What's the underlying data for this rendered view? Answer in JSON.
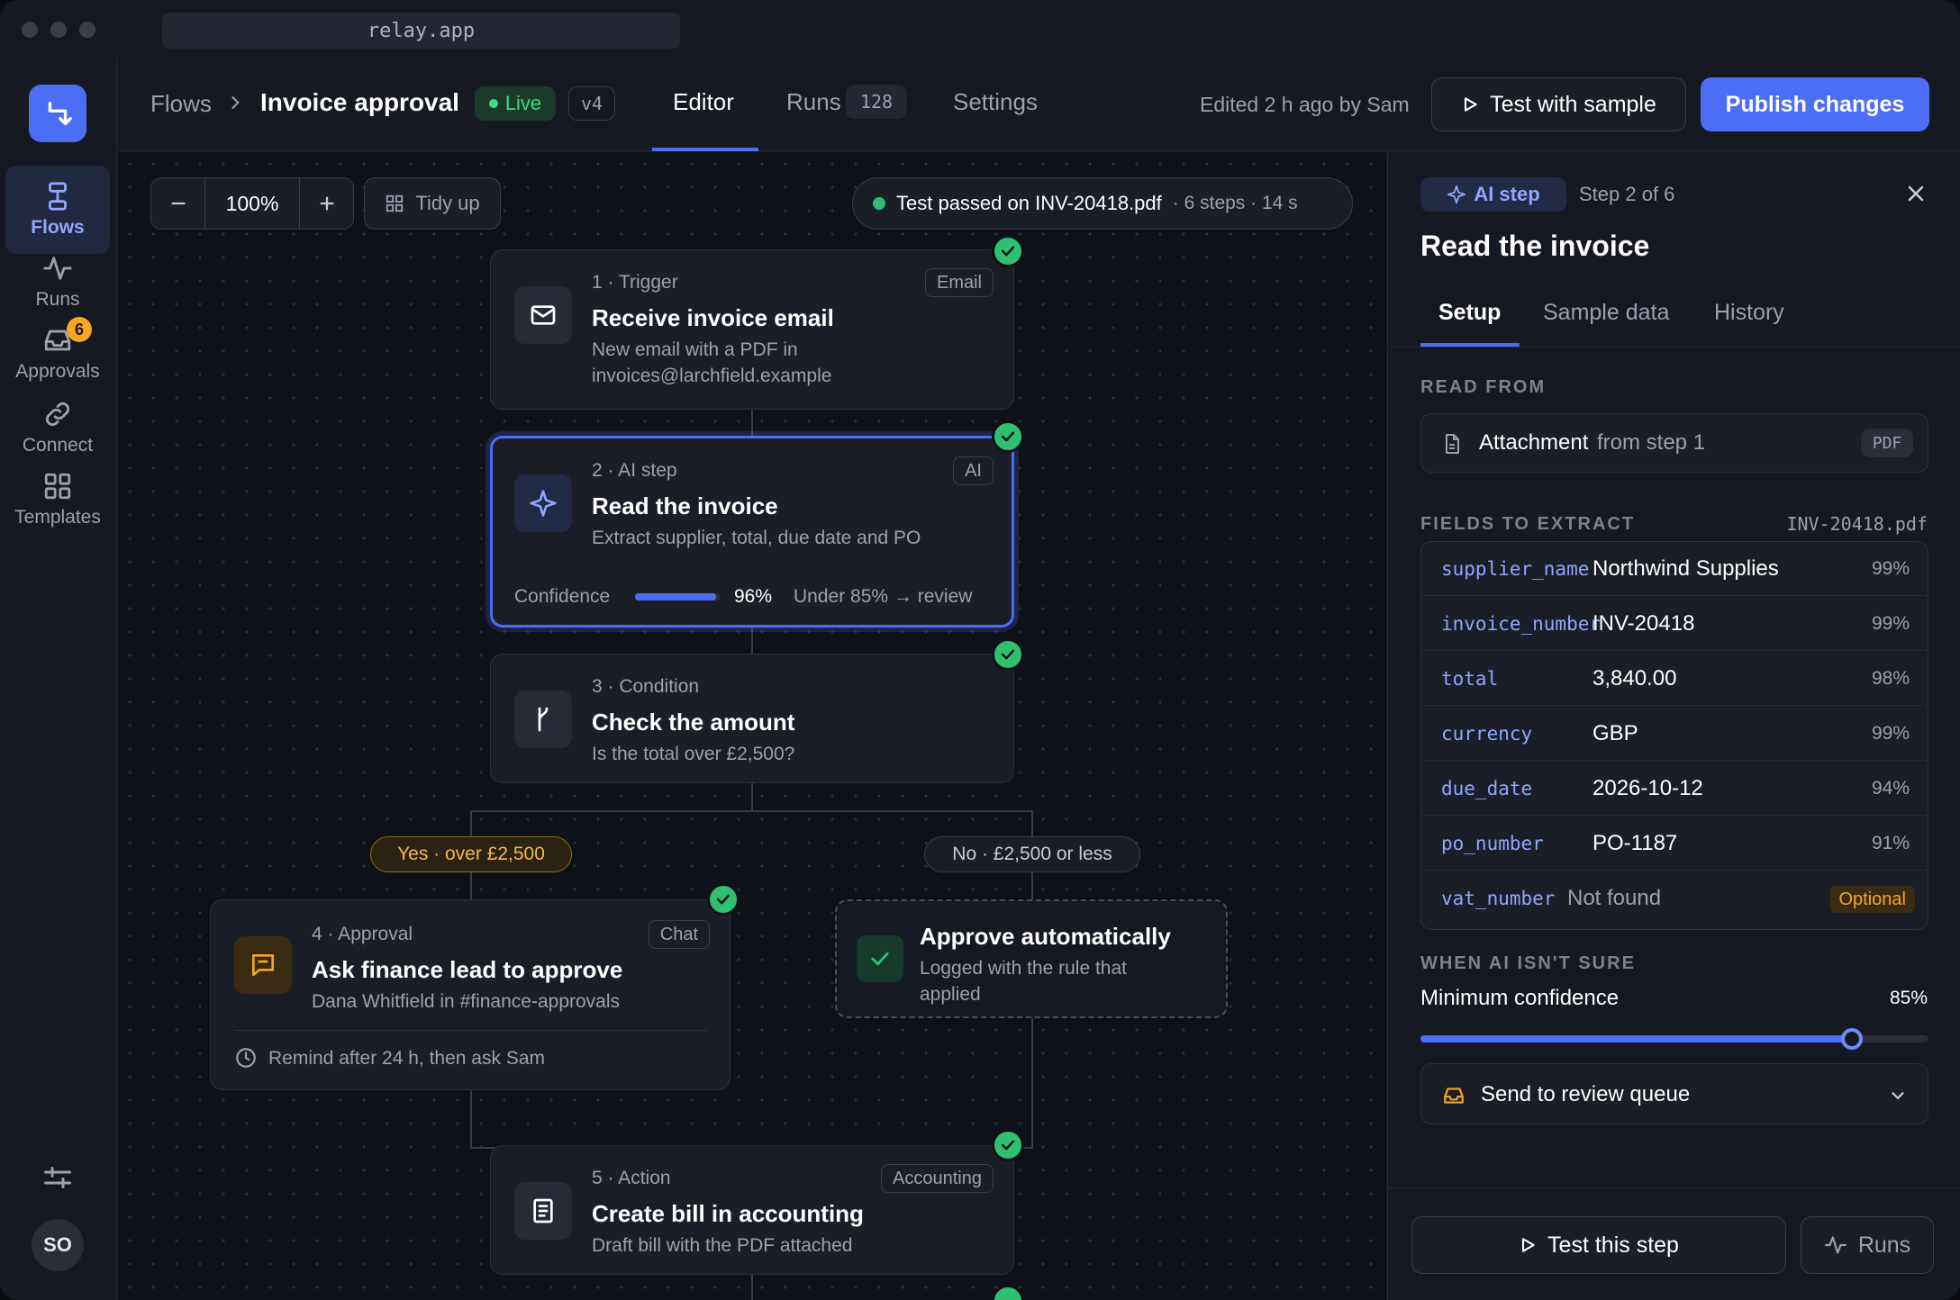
{
  "browser": {
    "url": "relay.app"
  },
  "rail": {
    "items": [
      {
        "label": "Flows"
      },
      {
        "label": "Runs"
      },
      {
        "label": "Approvals",
        "badge": "6"
      },
      {
        "label": "Connect"
      },
      {
        "label": "Templates"
      }
    ],
    "avatar": "SO"
  },
  "header": {
    "breadcrumb_root": "Flows",
    "flow_title": "Invoice approval",
    "status": "Live",
    "version": "v4",
    "tabs": [
      {
        "label": "Editor"
      },
      {
        "label": "Runs",
        "count": "128"
      },
      {
        "label": "Settings"
      }
    ],
    "edited": "Edited 2 h ago by Sam",
    "test_button": "Test with sample",
    "publish_button": "Publish changes"
  },
  "toolbar": {
    "zoom": "100%",
    "tidy_label": "Tidy up",
    "test_status": "Test passed on INV-20418.pdf",
    "test_meta": "· 6 steps · 14 s"
  },
  "nodes": {
    "n1": {
      "meta": "1 · Trigger",
      "tag": "Email",
      "title": "Receive invoice email",
      "sub1": "New email with a PDF in",
      "sub2": "invoices@larchfield.example"
    },
    "n2": {
      "meta": "2 · AI step",
      "tag": "AI",
      "title": "Read the invoice",
      "sub": "Extract supplier, total, due date and PO",
      "confidence_label": "Confidence",
      "confidence_value": "96%",
      "confidence_fraction": 0.96,
      "review_rule": "Under 85% → review"
    },
    "n3": {
      "meta": "3 · Condition",
      "title": "Check the amount",
      "sub": "Is the total over £2,500?"
    },
    "branch_yes": "Yes · over £2,500",
    "branch_no": "No · £2,500 or less",
    "n4": {
      "meta": "4 · Approval",
      "tag": "Chat",
      "title": "Ask finance lead to approve",
      "sub": "Dana Whitfield in #finance-approvals",
      "remind": "Remind after 24 h, then ask Sam"
    },
    "auto": {
      "title": "Approve automatically",
      "sub1": "Logged with the rule that",
      "sub2": "applied"
    },
    "n5": {
      "meta": "5 · Action",
      "tag": "Accounting",
      "title": "Create bill in accounting",
      "sub": "Draft bill with the PDF attached"
    }
  },
  "panel": {
    "kind": "AI step",
    "step_of": "Step 2 of 6",
    "title": "Read the invoice",
    "tabs": [
      {
        "label": "Setup"
      },
      {
        "label": "Sample data"
      },
      {
        "label": "History"
      }
    ],
    "read_from_heading": "READ FROM",
    "read_from_main": "Attachment",
    "read_from_rest": "from step 1",
    "read_from_tag": "PDF",
    "fields_heading": "FIELDS TO EXTRACT",
    "fields_file": "INV-20418.pdf",
    "fields": [
      {
        "key": "supplier_name",
        "value": "Northwind Supplies",
        "pct": "99%"
      },
      {
        "key": "invoice_number",
        "value": "INV-20418",
        "pct": "99%"
      },
      {
        "key": "total",
        "value": "3,840.00",
        "pct": "98%"
      },
      {
        "key": "currency",
        "value": "GBP",
        "pct": "99%"
      },
      {
        "key": "due_date",
        "value": "2026-10-12",
        "pct": "94%"
      },
      {
        "key": "po_number",
        "value": "PO-1187",
        "pct": "91%"
      },
      {
        "key": "vat_number",
        "value": "Not found",
        "pct": "Optional"
      }
    ],
    "unsure_heading": "WHEN AI ISN'T SURE",
    "min_conf_label": "Minimum confidence",
    "min_conf_value": "85%",
    "min_conf_fraction": 0.85,
    "queue_select": "Send to review queue",
    "test_step": "Test this step",
    "runs": "Runs"
  },
  "colors": {
    "accent": "#4c6ef5",
    "success": "#2fbf71",
    "warning": "#f5a623"
  }
}
